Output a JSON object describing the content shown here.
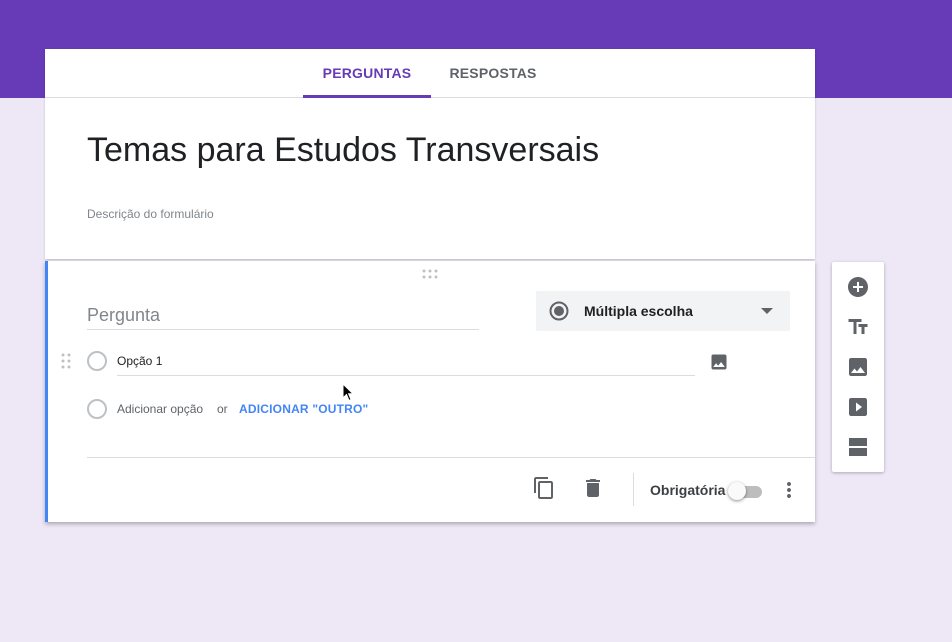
{
  "tabs": [
    {
      "label": "PERGUNTAS",
      "active": true
    },
    {
      "label": "RESPOSTAS",
      "active": false
    }
  ],
  "form": {
    "title": "Temas para Estudos Transversais",
    "description_placeholder": "Descrição do formulário"
  },
  "question": {
    "placeholder": "Pergunta",
    "type_label": "Múltipla escolha",
    "options": [
      {
        "label": "Opção 1"
      }
    ],
    "add_option_label": "Adicionar opção",
    "or_label": "or",
    "add_other_label": "ADICIONAR \"OUTRO\"",
    "required_label": "Obrigatória",
    "required": false
  },
  "sidebar_tools": [
    "add-question-icon",
    "add-title-icon",
    "add-image-icon",
    "add-video-icon",
    "add-section-icon"
  ],
  "colors": {
    "header": "#673ab7",
    "background": "#ede7f6",
    "accent": "#4285f4",
    "active_tab": "#673ab7"
  }
}
